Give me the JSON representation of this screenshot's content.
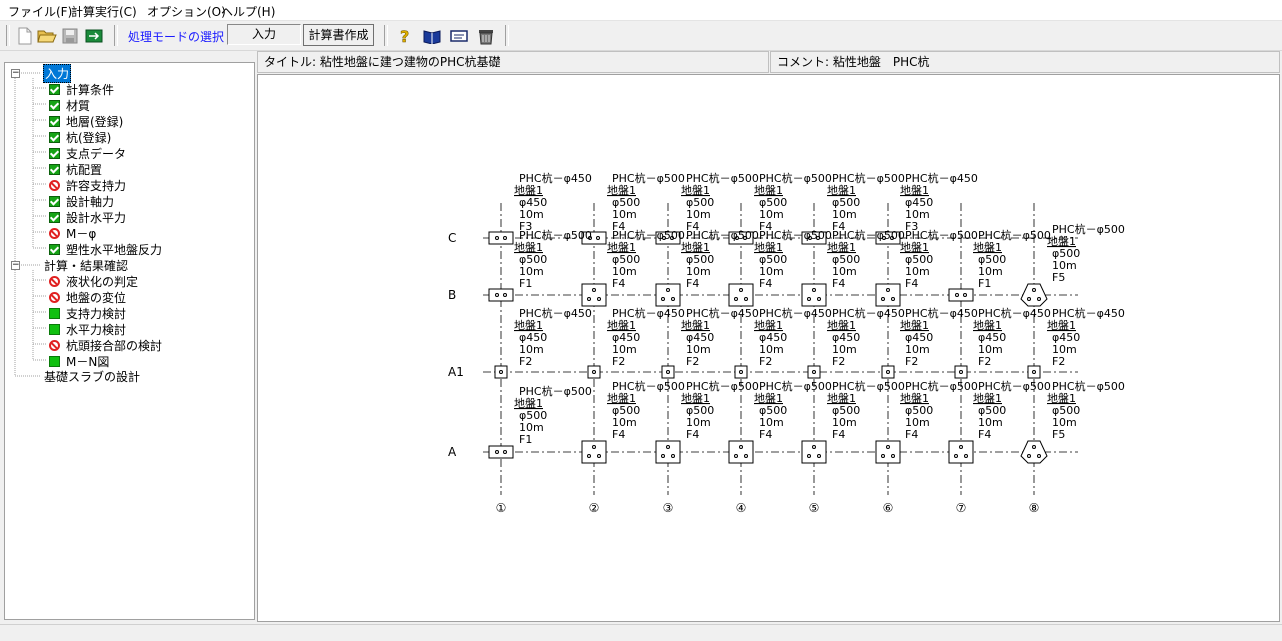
{
  "menu": {
    "file": "ファイル(F)",
    "calc": "計算実行(C)",
    "options": "オプション(O)",
    "help": "ヘルプ(H)"
  },
  "toolbar": {
    "mode_select": "処理モードの選択",
    "mode_value": "入力",
    "report_button": "計算書作成",
    "icons": [
      "new-file-icon",
      "open-folder-icon",
      "save-icon",
      "export-icon",
      "help-icon",
      "book-icon",
      "keyboard-icon",
      "trash-icon"
    ]
  },
  "tree": {
    "input_root": "入力",
    "input_items": [
      {
        "label": "計算条件",
        "state": "check"
      },
      {
        "label": "材質",
        "state": "check"
      },
      {
        "label": "地層(登録)",
        "state": "check"
      },
      {
        "label": "杭(登録)",
        "state": "check"
      },
      {
        "label": "支点データ",
        "state": "check"
      },
      {
        "label": "杭配置",
        "state": "check"
      },
      {
        "label": "許容支持力",
        "state": "prohibit"
      },
      {
        "label": "設計軸力",
        "state": "check"
      },
      {
        "label": "設計水平力",
        "state": "check"
      },
      {
        "label": "M－φ",
        "state": "prohibit"
      },
      {
        "label": "塑性水平地盤反力",
        "state": "check"
      }
    ],
    "calc_root": "計算・結果確認",
    "calc_items": [
      {
        "label": "液状化の判定",
        "state": "prohibit"
      },
      {
        "label": "地盤の変位",
        "state": "prohibit"
      },
      {
        "label": "支持力検討",
        "state": "plain"
      },
      {
        "label": "水平力検討",
        "state": "plain"
      },
      {
        "label": "杭頭接合部の検討",
        "state": "prohibit"
      },
      {
        "label": "M－N図",
        "state": "plain"
      }
    ],
    "slab_item": "基礎スラブの設計"
  },
  "info": {
    "title": "タイトル: 粘性地盤に建つ建物のPHC杭基礎",
    "comment": "コメント: 粘性地盤　PHC杭"
  },
  "plan": {
    "rows": [
      "C",
      "B",
      "A1",
      "A"
    ],
    "columns": [
      "①",
      "②",
      "③",
      "④",
      "⑤",
      "⑥",
      "⑦",
      "⑧"
    ],
    "labels": [
      {
        "lines": [
          "PHC杭－φ450",
          "地盤1",
          "φ450",
          "10m",
          "F3"
        ]
      },
      {
        "lines": [
          "PHC杭－φ500",
          "地盤1",
          "φ500",
          "10m",
          "F1"
        ]
      },
      {
        "lines": [
          "PHC杭－φ500",
          "地盤1",
          "φ500",
          "10m",
          "F4"
        ]
      },
      {
        "lines": [
          "PHC杭－φ450",
          "地盤1",
          "φ450",
          "10m",
          "F2"
        ]
      },
      {
        "lines": [
          "PHC杭－φ500",
          "地盤1",
          "φ500",
          "10m",
          "F5"
        ]
      }
    ]
  }
}
